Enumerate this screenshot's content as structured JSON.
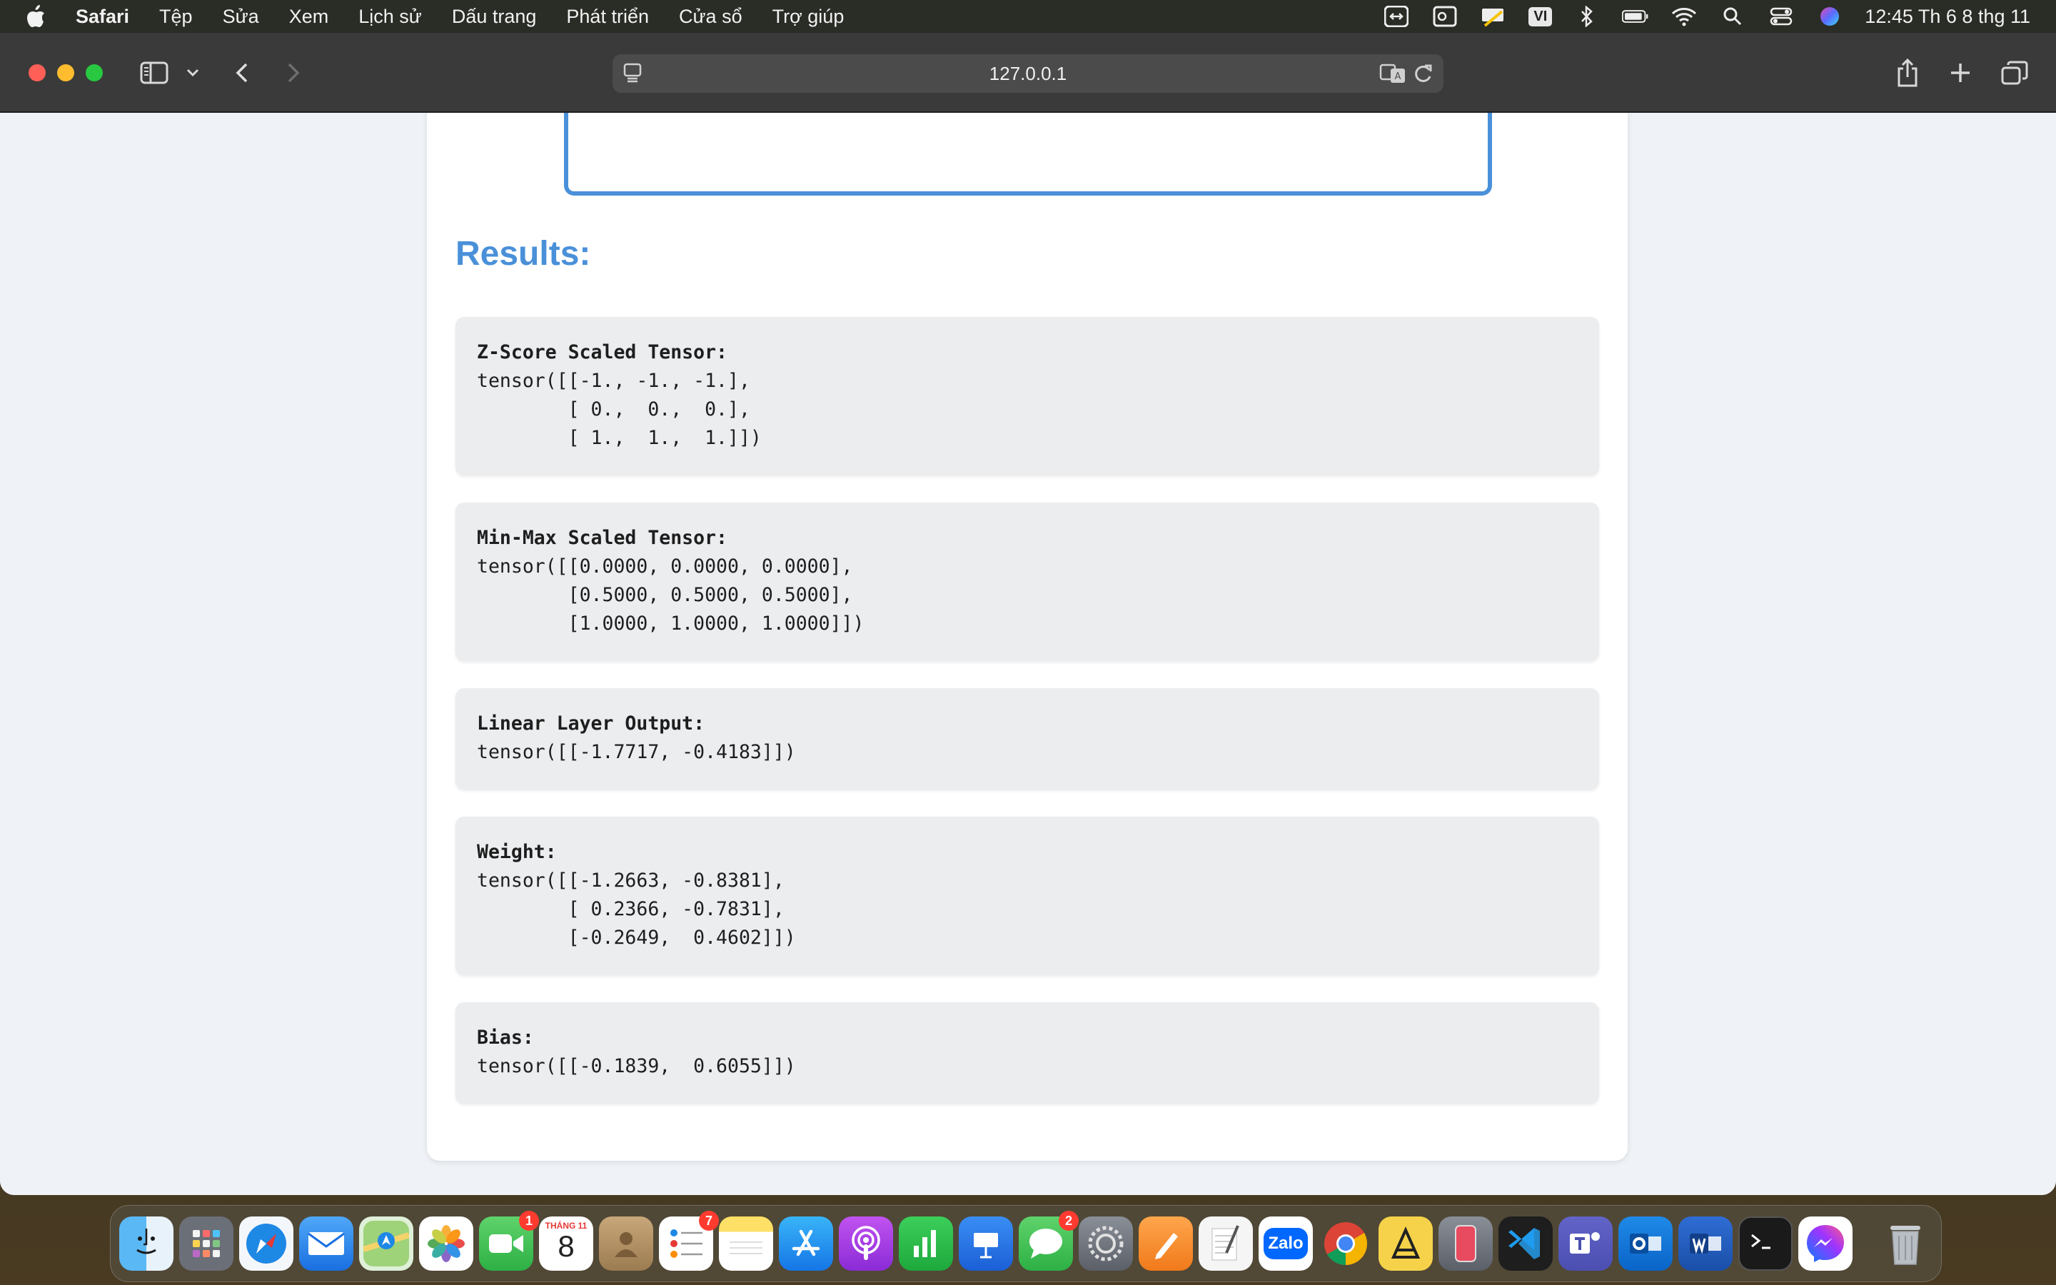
{
  "menubar": {
    "app_name": "Safari",
    "items": [
      "Tệp",
      "Sửa",
      "Xem",
      "Lịch sử",
      "Dấu trang",
      "Phát triển",
      "Cửa sổ",
      "Trợ giúp"
    ],
    "keyboard_input": "VI",
    "clock": "12:45 Th 6 8 thg 11"
  },
  "browser": {
    "url": "127.0.0.1"
  },
  "page": {
    "results_title": "Results:",
    "results": [
      {
        "label": "Z-Score Scaled Tensor:",
        "value": "tensor([[-1., -1., -1.],\n        [ 0.,  0.,  0.],\n        [ 1.,  1.,  1.]])"
      },
      {
        "label": "Min-Max Scaled Tensor:",
        "value": "tensor([[0.0000, 0.0000, 0.0000],\n        [0.5000, 0.5000, 0.5000],\n        [1.0000, 1.0000, 1.0000]])"
      },
      {
        "label": "Linear Layer Output:",
        "value": "tensor([[-1.7717, -0.4183]])"
      },
      {
        "label": "Weight:",
        "value": "tensor([[-1.2663, -0.8381],\n        [ 0.2366, -0.7831],\n        [-0.2649,  0.4602]])"
      },
      {
        "label": "Bias:",
        "value": "tensor([[-0.1839,  0.6055]])"
      }
    ]
  },
  "dock": {
    "calendar_month": "THÁNG 11",
    "calendar_day": "8",
    "zalo_label": "Zalo",
    "facetime_badge": "1",
    "reminders_badge": "7",
    "messages_badge": "2"
  },
  "colors": {
    "accent": "#4a90d9",
    "card_bg": "#ebedef",
    "page_bg": "#eff2f6"
  }
}
